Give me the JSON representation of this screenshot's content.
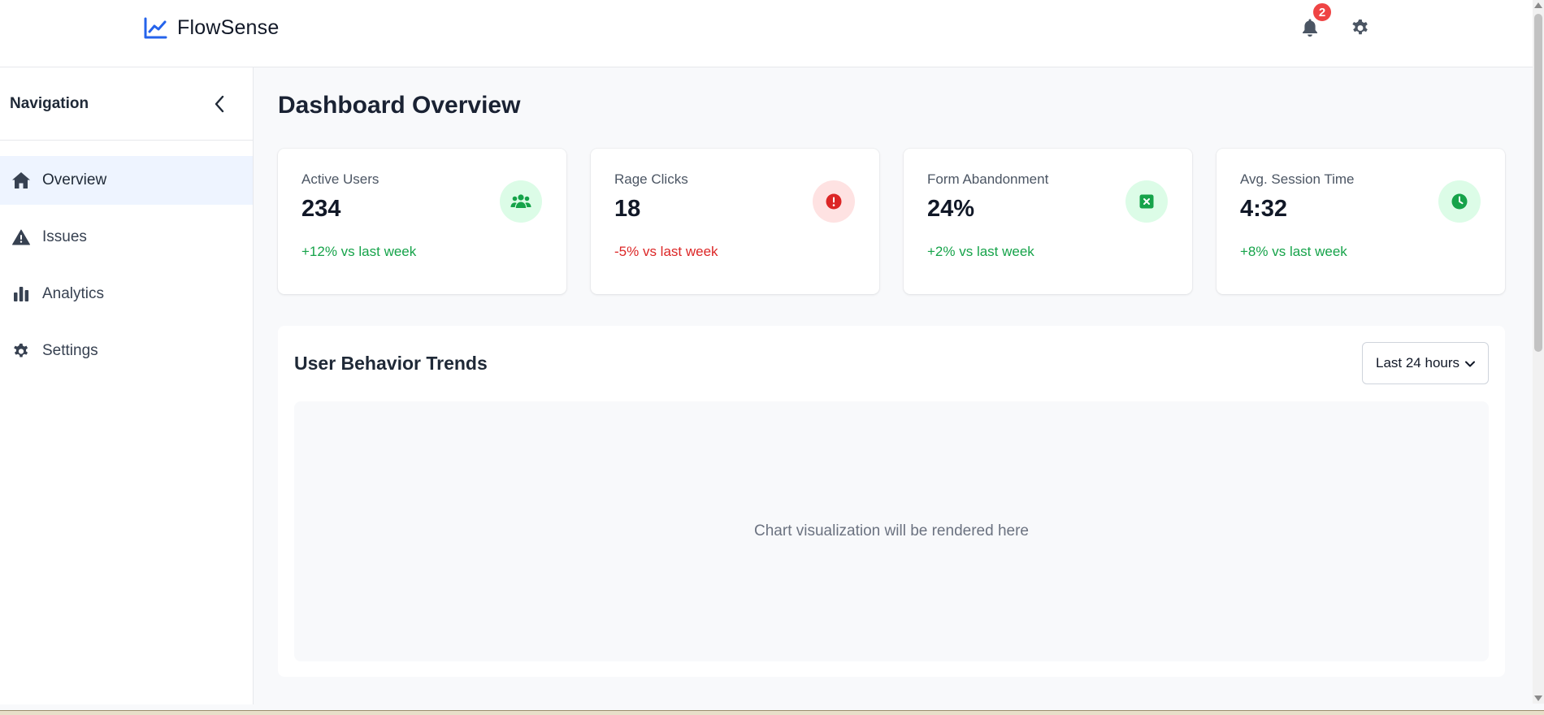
{
  "header": {
    "brand_name": "FlowSense",
    "notification_count": "2"
  },
  "sidebar": {
    "title": "Navigation",
    "items": [
      {
        "label": "Overview",
        "icon": "home-icon",
        "active": true
      },
      {
        "label": "Issues",
        "icon": "warning-icon",
        "active": false
      },
      {
        "label": "Analytics",
        "icon": "bar-chart-icon",
        "active": false
      },
      {
        "label": "Settings",
        "icon": "gear-icon",
        "active": false
      }
    ]
  },
  "main": {
    "page_title": "Dashboard Overview",
    "stats": [
      {
        "label": "Active Users",
        "value": "234",
        "change": "+12% vs last week",
        "trend": "up",
        "icon": "users-icon",
        "icon_color": "#16a34a"
      },
      {
        "label": "Rage Clicks",
        "value": "18",
        "change": "-5% vs last week",
        "trend": "down",
        "icon": "alert-circle-icon",
        "icon_color": "#dc2626"
      },
      {
        "label": "Form Abandonment",
        "value": "24%",
        "change": "+2% vs last week",
        "trend": "up",
        "icon": "form-x-icon",
        "icon_color": "#16a34a"
      },
      {
        "label": "Avg. Session Time",
        "value": "4:32",
        "change": "+8% vs last week",
        "trend": "up",
        "icon": "clock-icon",
        "icon_color": "#16a34a"
      }
    ],
    "trends": {
      "title": "User Behavior Trends",
      "range_selected": "Last 24 hours",
      "placeholder": "Chart visualization will be rendered here"
    }
  },
  "colors": {
    "accent": "#2563eb",
    "positive": "#16a34a",
    "negative": "#dc2626",
    "badge": "#ef4444",
    "nav_active_bg": "#eef4ff"
  }
}
